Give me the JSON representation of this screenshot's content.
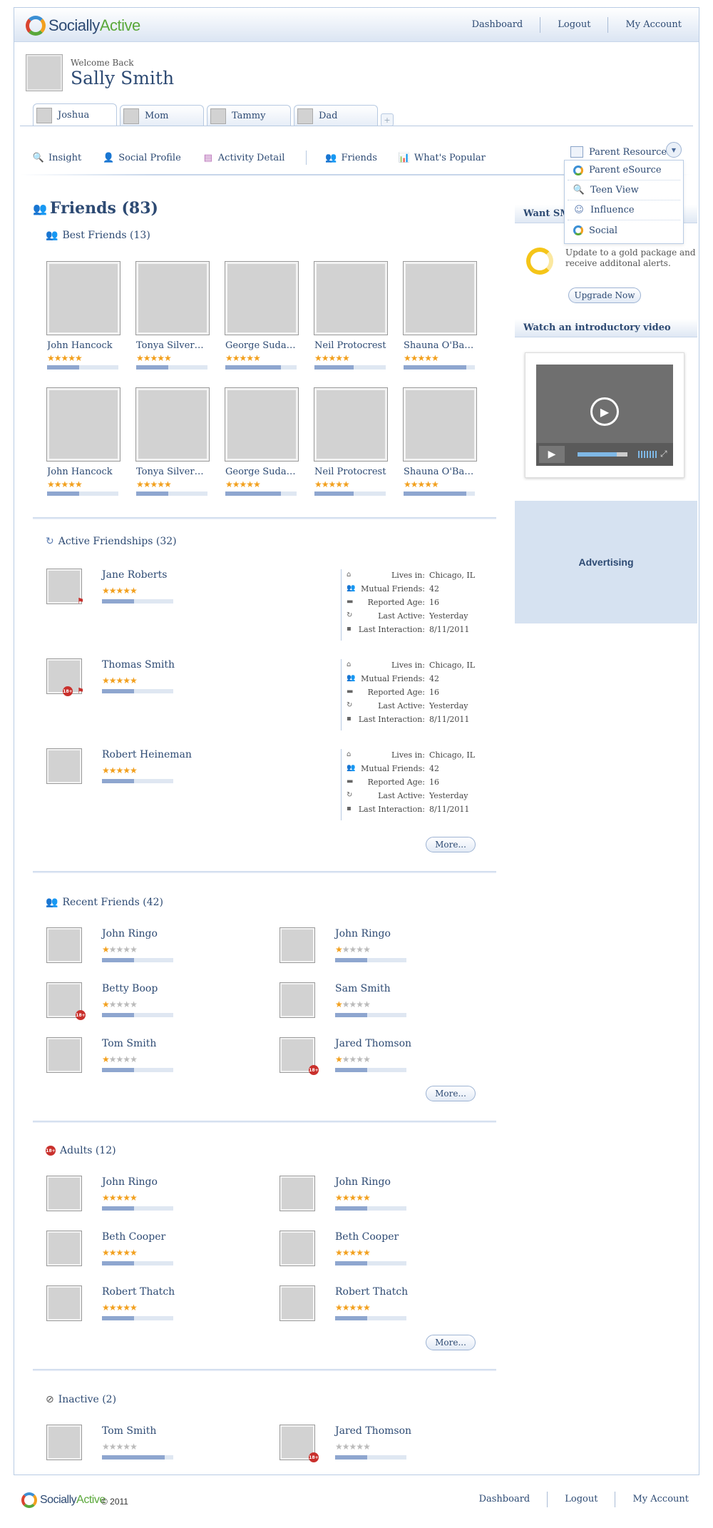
{
  "header": {
    "brand_main": "Socially",
    "brand_accent": "Active",
    "nav": [
      "Dashboard",
      "Logout",
      "My Account"
    ]
  },
  "welcome": {
    "greeting": "Welcome Back",
    "name": "Sally Smith"
  },
  "tabs": [
    "Joshua",
    "Mom",
    "Tammy",
    "Dad"
  ],
  "tab_add": "+",
  "subnav": [
    {
      "label": "Insight",
      "icon": "insight-icon"
    },
    {
      "label": "Social Profile",
      "icon": "profile-icon"
    },
    {
      "label": "Activity Detail",
      "icon": "activity-icon"
    },
    {
      "label": "Friends",
      "icon": "friends-icon"
    },
    {
      "label": "What's Popular",
      "icon": "popular-icon"
    }
  ],
  "parent_resources": {
    "label": "Parent Resources",
    "items": [
      "Parent eSource",
      "Teen View",
      "Influence",
      "Social"
    ]
  },
  "friends": {
    "title": "Friends (83)",
    "best": {
      "title": "Best Friends (13)",
      "cards": [
        {
          "name": "John Hancock",
          "stars": 5,
          "level": 0.45
        },
        {
          "name": "Tonya Silverman",
          "stars": 5,
          "level": 0.45
        },
        {
          "name": "George Sudaga...",
          "stars": 5,
          "level": 0.78
        },
        {
          "name": "Neil Protocrest",
          "stars": 5,
          "level": 0.55
        },
        {
          "name": "Shauna O'Bann...",
          "stars": 5,
          "level": 0.88
        },
        {
          "name": "John Hancock",
          "stars": 5,
          "level": 0.45
        },
        {
          "name": "Tonya Silverman",
          "stars": 5,
          "level": 0.45
        },
        {
          "name": "George Sudaga...",
          "stars": 5,
          "level": 0.78
        },
        {
          "name": "Neil Protocrest",
          "stars": 5,
          "level": 0.55
        },
        {
          "name": "Shauna O'Bann...",
          "stars": 5,
          "level": 0.88
        }
      ]
    },
    "active": {
      "title": "Active Friendships (32)",
      "labels": [
        "Lives in:",
        "Mutual Friends:",
        "Reported Age:",
        "Last Active:",
        "Last Interaction:"
      ],
      "rows": [
        {
          "name": "Jane Roberts",
          "stars": 5,
          "level": 0.45,
          "values": [
            "Chicago, IL",
            "42",
            "16",
            "Yesterday",
            "8/11/2011"
          ]
        },
        {
          "name": "Thomas Smith",
          "stars": 5,
          "level": 0.45,
          "values": [
            "Chicago, IL",
            "42",
            "16",
            "Yesterday",
            "8/11/2011"
          ]
        },
        {
          "name": "Robert Heineman",
          "stars": 5,
          "level": 0.45,
          "values": [
            "Chicago, IL",
            "42",
            "16",
            "Yesterday",
            "8/11/2011"
          ]
        }
      ],
      "more": "More..."
    },
    "recent": {
      "title": "Recent Friends (42)",
      "rows": [
        {
          "name": "John Ringo",
          "stars": 1,
          "level": 0.45
        },
        {
          "name": "John Ringo",
          "stars": 1,
          "level": 0.45
        },
        {
          "name": "Betty Boop",
          "stars": 1,
          "level": 0.45
        },
        {
          "name": "Sam Smith",
          "stars": 1,
          "level": 0.45
        },
        {
          "name": "Tom Smith",
          "stars": 1,
          "level": 0.45
        },
        {
          "name": "Jared Thomson",
          "stars": 1,
          "level": 0.45
        }
      ],
      "more": "More..."
    },
    "adults": {
      "title": "Adults (12)",
      "rows": [
        {
          "name": "John Ringo",
          "stars": 5,
          "level": 0.45
        },
        {
          "name": "John Ringo",
          "stars": 5,
          "level": 0.45
        },
        {
          "name": "Beth Cooper",
          "stars": 5,
          "level": 0.45
        },
        {
          "name": "Beth Cooper",
          "stars": 5,
          "level": 0.45
        },
        {
          "name": "Robert Thatch",
          "stars": 5,
          "level": 0.45
        },
        {
          "name": "Robert Thatch",
          "stars": 5,
          "level": 0.45
        }
      ],
      "more": "More..."
    },
    "inactive": {
      "title": "Inactive (2)",
      "rows": [
        {
          "name": "Tom Smith",
          "stars": 0,
          "level": 0.88
        },
        {
          "name": "Jared Thomson",
          "stars": 0,
          "level": 0.45
        }
      ]
    }
  },
  "adult_badge": "18+",
  "sidebar": {
    "sms_title": "Want SMS Alerts?",
    "sms_text": "Update to a gold package and receive additonal alerts.",
    "upgrade": "Upgrade Now",
    "video_title": "Watch an introductory video",
    "ad": "Advertising"
  },
  "footer": {
    "copyright": "© 2011",
    "nav": [
      "Dashboard",
      "Logout",
      "My Account"
    ]
  },
  "colors": {
    "accent": "#2d4a73",
    "star": "#f2a01e",
    "badge": "#c9302c",
    "ad_bg": "#d6e2f1"
  }
}
